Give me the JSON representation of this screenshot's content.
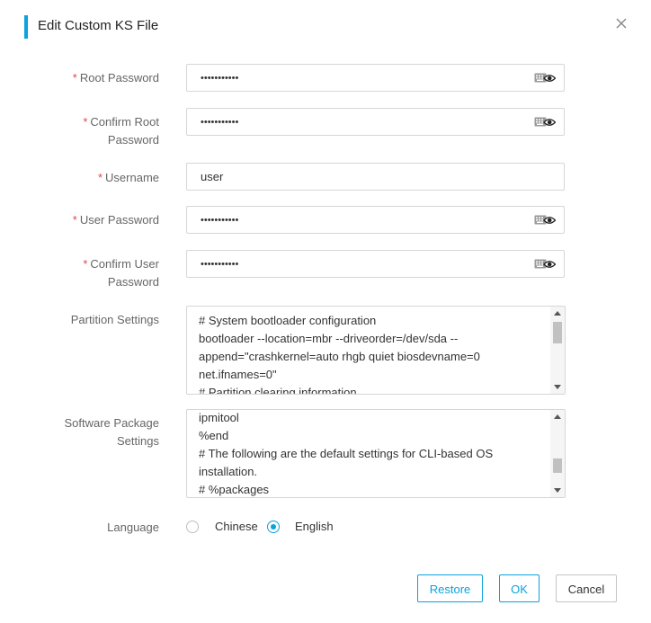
{
  "dialog": {
    "title": "Edit Custom KS File",
    "close_icon": "close-icon"
  },
  "form": {
    "required_mark": "*",
    "root_password": {
      "label": "Root Password",
      "value": "•••••••••••"
    },
    "confirm_root_password": {
      "label_line1": "Confirm Root",
      "label_line2": "Password",
      "value": "•••••••••••"
    },
    "username": {
      "label": "Username",
      "value": "user"
    },
    "user_password": {
      "label": "User Password",
      "value": "•••••••••••"
    },
    "confirm_user_password": {
      "label_line1": "Confirm User",
      "label_line2": "Password",
      "value": "•••••••••••"
    },
    "partition_settings": {
      "label": "Partition Settings",
      "text": "# System bootloader configuration\nbootloader --location=mbr --driveorder=/dev/sda --append=\"crashkernel=auto rhgb quiet biosdevname=0 net.ifnames=0\"\n# Partition clearing information"
    },
    "software_package_settings": {
      "label_line1": "Software Package",
      "label_line2": "Settings",
      "text": "ipmitool\n%end\n# The following are the default settings for CLI-based OS installation.\n# %packages"
    },
    "language": {
      "label": "Language",
      "options": [
        "Chinese",
        "English"
      ],
      "selected": "English"
    }
  },
  "buttons": {
    "restore": "Restore",
    "ok": "OK",
    "cancel": "Cancel"
  },
  "icons": {
    "password_toggle": "keyboard-eye-icon"
  },
  "colors": {
    "accent": "#0aa3dd",
    "required": "#e54545"
  }
}
